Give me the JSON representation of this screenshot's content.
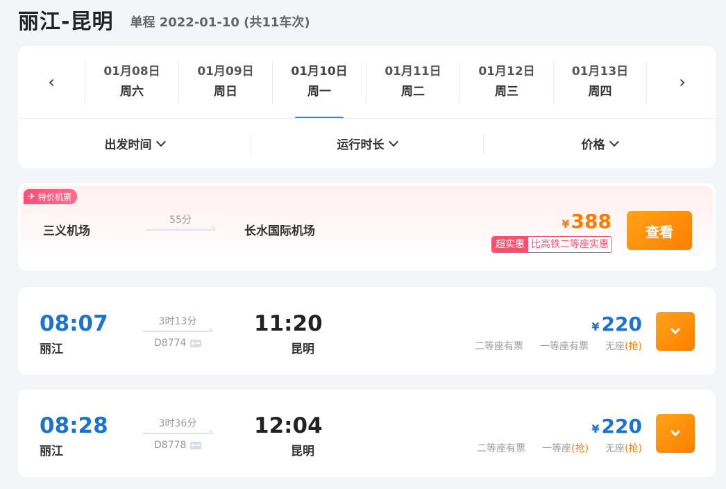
{
  "header": {
    "route": "丽江-昆明",
    "meta": "单程 2022-01-10 (共11车次)"
  },
  "dates": [
    {
      "date": "01月08日",
      "weekday": "周六"
    },
    {
      "date": "01月09日",
      "weekday": "周日"
    },
    {
      "date": "01月10日",
      "weekday": "周一",
      "active": true
    },
    {
      "date": "01月11日",
      "weekday": "周二"
    },
    {
      "date": "01月12日",
      "weekday": "周三"
    },
    {
      "date": "01月13日",
      "weekday": "周四"
    }
  ],
  "sort": {
    "depart": "出发时间",
    "duration": "运行时长",
    "price": "价格"
  },
  "flight": {
    "tag": "特价机票",
    "from": "三义机场",
    "duration": "55分",
    "to": "长水国际机场",
    "currency": "¥",
    "price": "388",
    "badge_a": "超实惠",
    "badge_b": "比高铁二等座实惠",
    "button": "查看"
  },
  "trains": [
    {
      "dep_time": "08:07",
      "dep_station": "丽江",
      "duration": "3时13分",
      "train_no": "D8774",
      "arr_time": "11:20",
      "arr_station": "昆明",
      "currency": "¥",
      "price": "220",
      "seats": [
        {
          "name": "二等座有票",
          "grab": ""
        },
        {
          "name": "一等座有票",
          "grab": ""
        },
        {
          "name": "无座",
          "grab": "(抢)"
        }
      ]
    },
    {
      "dep_time": "08:28",
      "dep_station": "丽江",
      "duration": "3时36分",
      "train_no": "D8778",
      "arr_time": "12:04",
      "arr_station": "昆明",
      "currency": "¥",
      "price": "220",
      "seats": [
        {
          "name": "二等座有票",
          "grab": ""
        },
        {
          "name": "一等座",
          "grab": "(抢)"
        },
        {
          "name": "无座",
          "grab": "(抢)"
        }
      ]
    }
  ],
  "colors": {
    "blue": "#1a73d1",
    "orange": "#ff7a00",
    "pink": "#ff4d6d"
  },
  "icons": [
    "chevron-left-icon",
    "chevron-right-icon",
    "chevron-down-icon",
    "plane-icon",
    "id-card-icon"
  ]
}
